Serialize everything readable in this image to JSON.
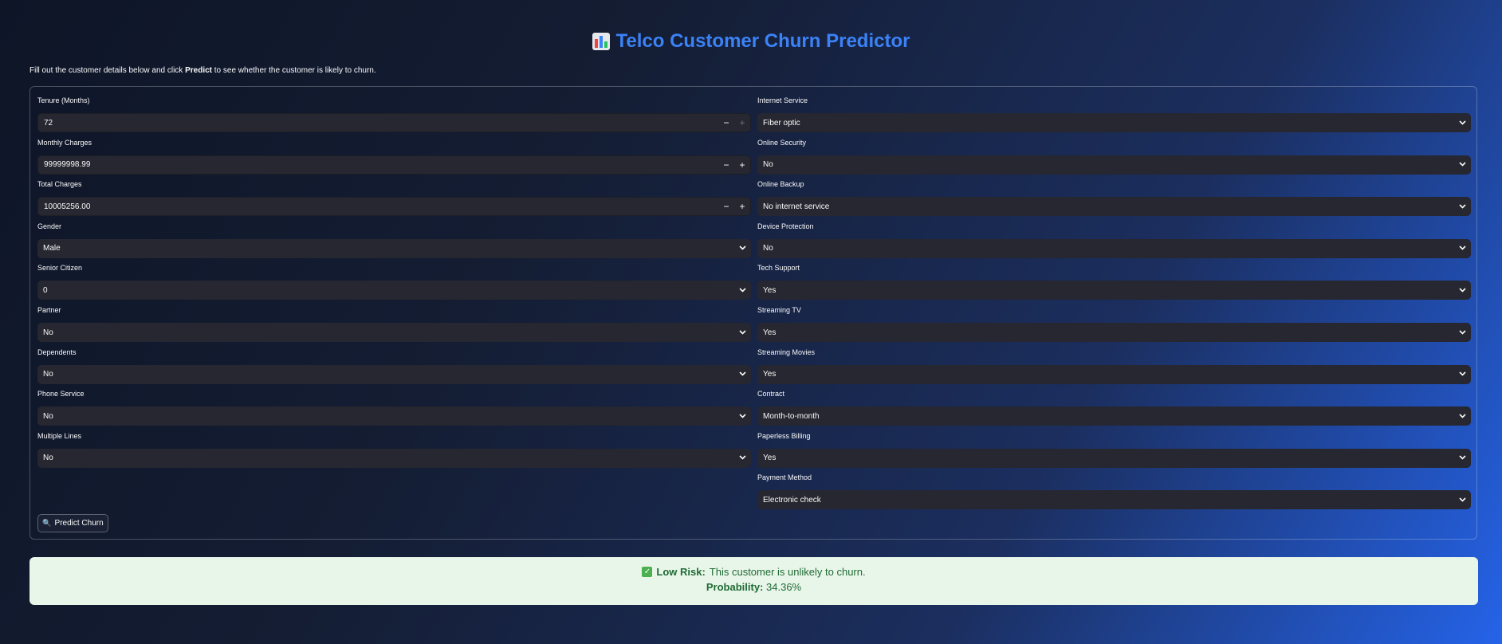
{
  "header": {
    "title": "Telco Customer Churn Predictor",
    "icon": "bar-chart-icon"
  },
  "intro": {
    "before": "Fill out the customer details below and click ",
    "bold": "Predict",
    "after": " to see whether the customer is likely to churn."
  },
  "left_fields": [
    {
      "label": "Tenure (Months)",
      "value": "72",
      "kind": "number"
    },
    {
      "label": "Monthly Charges",
      "value": "99999998.99",
      "kind": "number"
    },
    {
      "label": "Total Charges",
      "value": "10005256.00",
      "kind": "number"
    },
    {
      "label": "Gender",
      "value": "Male",
      "kind": "select"
    },
    {
      "label": "Senior Citizen",
      "value": "0",
      "kind": "select"
    },
    {
      "label": "Partner",
      "value": "No",
      "kind": "select"
    },
    {
      "label": "Dependents",
      "value": "No",
      "kind": "select"
    },
    {
      "label": "Phone Service",
      "value": "No",
      "kind": "select"
    },
    {
      "label": "Multiple Lines",
      "value": "No",
      "kind": "select"
    }
  ],
  "right_fields": [
    {
      "label": "Internet Service",
      "value": "Fiber optic"
    },
    {
      "label": "Online Security",
      "value": "No"
    },
    {
      "label": "Online Backup",
      "value": "No internet service"
    },
    {
      "label": "Device Protection",
      "value": "No"
    },
    {
      "label": "Tech Support",
      "value": "Yes"
    },
    {
      "label": "Streaming TV",
      "value": "Yes"
    },
    {
      "label": "Streaming Movies",
      "value": "Yes"
    },
    {
      "label": "Contract",
      "value": "Month-to-month"
    },
    {
      "label": "Paperless Billing",
      "value": "Yes"
    },
    {
      "label": "Payment Method",
      "value": "Electronic check"
    }
  ],
  "stepper": {
    "minus": "−",
    "plus": "+"
  },
  "predict_button": {
    "icon": "🔍",
    "label": "Predict Churn"
  },
  "result": {
    "status_icon": "✓",
    "risk_label": "Low Risk:",
    "risk_text": "This customer is unlikely to churn.",
    "prob_label": "Probability:",
    "prob_value": "34.36%"
  },
  "colors": {
    "accent": "#3b82f6",
    "success_bg": "#e8f5e9",
    "success_text": "#1f6b34",
    "input_bg": "#262730"
  }
}
